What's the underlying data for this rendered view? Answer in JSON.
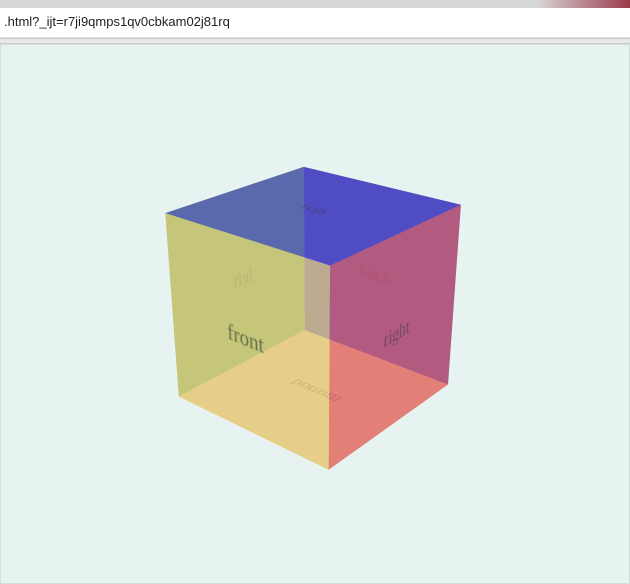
{
  "browser": {
    "url_fragment": ".html?_ijt=r7ji9qmps1qv0cbkam02j81rq"
  },
  "cube": {
    "faces": {
      "front": "front",
      "back": "back",
      "right": "right",
      "left": "left",
      "top": "top",
      "bottom": "bottom"
    }
  }
}
